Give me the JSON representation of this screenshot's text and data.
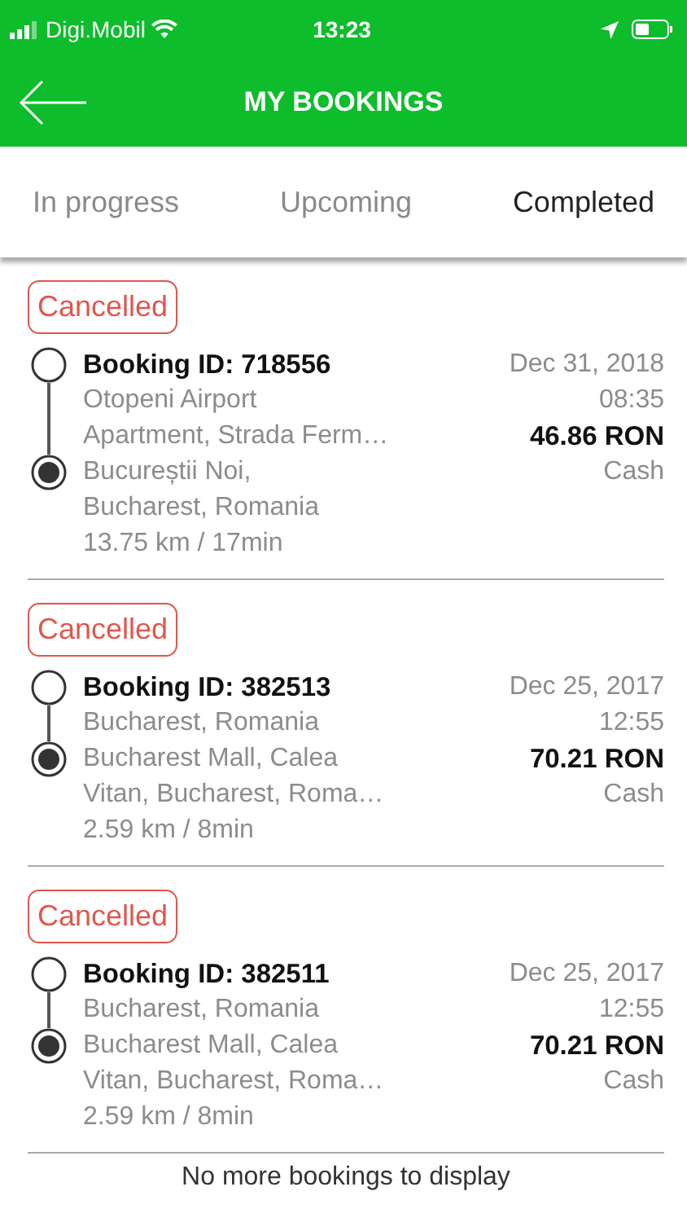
{
  "status_bar": {
    "carrier": "Digi.Mobil",
    "time": "13:23"
  },
  "header": {
    "title": "MY BOOKINGS"
  },
  "tabs": [
    {
      "label": "In progress",
      "selected": false
    },
    {
      "label": "Upcoming",
      "selected": false
    },
    {
      "label": "Completed",
      "selected": true
    }
  ],
  "bookings": [
    {
      "status": "Cancelled",
      "booking_id": "Booking ID: 718556",
      "pickup_lines": [
        "Otopeni Airport",
        "Apartment, Strada Ferm…"
      ],
      "dropoff_lines": [
        "Bucureștii Noi,",
        "Bucharest, Romania"
      ],
      "distance": "13.75 km / 17min",
      "date": "Dec 31, 2018",
      "time": "08:35",
      "price": "46.86 RON",
      "payment": "Cash"
    },
    {
      "status": "Cancelled",
      "booking_id": "Booking ID: 382513",
      "pickup_lines": [
        "Bucharest, Romania"
      ],
      "dropoff_lines": [
        "Bucharest Mall, Calea",
        "Vitan, Bucharest, Roma…"
      ],
      "distance": "2.59 km / 8min",
      "date": "Dec 25, 2017",
      "time": "12:55",
      "price": "70.21 RON",
      "payment": "Cash"
    },
    {
      "status": "Cancelled",
      "booking_id": "Booking ID: 382511",
      "pickup_lines": [
        "Bucharest, Romania"
      ],
      "dropoff_lines": [
        "Bucharest Mall, Calea",
        "Vitan, Bucharest, Roma…"
      ],
      "distance": "2.59 km / 8min",
      "date": "Dec 25, 2017",
      "time": "12:55",
      "price": "70.21 RON",
      "payment": "Cash"
    }
  ],
  "footer": "No more bookings to display"
}
